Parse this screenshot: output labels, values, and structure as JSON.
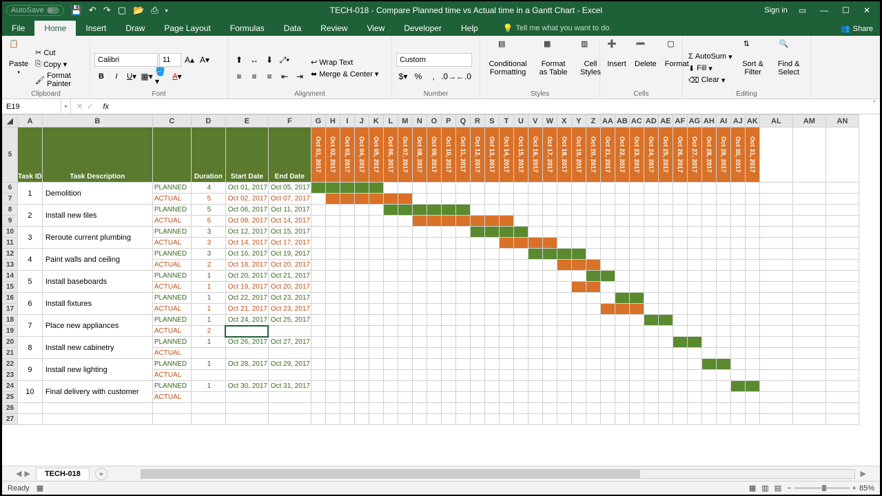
{
  "title": "TECH-018 - Compare Planned time vs Actual time in a Gantt Chart - Excel",
  "autosave": "AutoSave",
  "signin": "Sign in",
  "tabs": [
    "File",
    "Home",
    "Insert",
    "Draw",
    "Page Layout",
    "Formulas",
    "Data",
    "Review",
    "View",
    "Developer",
    "Help"
  ],
  "tellme": "Tell me what you want to do",
  "share": "Share",
  "ribbon": {
    "clipboard": {
      "label": "Clipboard",
      "paste": "Paste",
      "cut": "Cut",
      "copy": "Copy",
      "fp": "Format Painter"
    },
    "font": {
      "label": "Font",
      "name": "Calibri",
      "size": "11"
    },
    "alignment": {
      "label": "Alignment",
      "wrap": "Wrap Text",
      "merge": "Merge & Center"
    },
    "number": {
      "label": "Number",
      "format": "Custom"
    },
    "styles": {
      "label": "Styles",
      "cf": "Conditional Formatting",
      "fat": "Format as Table",
      "cs": "Cell Styles"
    },
    "cells": {
      "label": "Cells",
      "insert": "Insert",
      "delete": "Delete",
      "format": "Format"
    },
    "editing": {
      "label": "Editing",
      "sum": "AutoSum",
      "fill": "Fill",
      "clear": "Clear",
      "sort": "Sort & Filter",
      "find": "Find & Select"
    }
  },
  "namebox": "E19",
  "cols": [
    "A",
    "B",
    "C",
    "D",
    "E",
    "F",
    "G",
    "H",
    "I",
    "J",
    "K",
    "L",
    "M",
    "N",
    "O",
    "P",
    "Q",
    "R",
    "S",
    "T",
    "U",
    "V",
    "W",
    "X",
    "Y",
    "Z",
    "AA",
    "AB",
    "AC",
    "AD",
    "AE",
    "AF",
    "AG",
    "AH",
    "AI",
    "AJ",
    "AK",
    "AL",
    "AM",
    "AN"
  ],
  "headers": {
    "tid": "Task ID",
    "tdesc": "Task Description",
    "dur": "Duration",
    "sdate": "Start Date",
    "edate": "End Date"
  },
  "dates": [
    "Oct 01, 2017",
    "Oct 02, 2017",
    "Oct 03, 2017",
    "Oct 04, 2017",
    "Oct 05, 2017",
    "Oct 06, 2017",
    "Oct 07, 2017",
    "Oct 08, 2017",
    "Oct 09, 2017",
    "Oct 10, 2017",
    "Oct 11, 2017",
    "Oct 12, 2017",
    "Oct 13, 2017",
    "Oct 14, 2017",
    "Oct 15, 2017",
    "Oct 16, 2017",
    "Oct 17, 2017",
    "Oct 18, 2017",
    "Oct 19, 2017",
    "Oct 20, 2017",
    "Oct 21, 2017",
    "Oct 22, 2017",
    "Oct 23, 2017",
    "Oct 24, 2017",
    "Oct 25, 2017",
    "Oct 26, 2017",
    "Oct 27, 2017",
    "Oct 28, 2017",
    "Oct 29, 2017",
    "Oct 30, 2017",
    "Oct 31, 2017"
  ],
  "labels": {
    "planned": "PLANNED",
    "actual": "ACTUAL"
  },
  "tasks": [
    {
      "id": "1",
      "desc": "Demolition",
      "p": {
        "dur": "4",
        "s": "Oct 01, 2017",
        "e": "Oct 05, 2017",
        "g": [
          0,
          4
        ]
      },
      "a": {
        "dur": "5",
        "s": "Oct 02, 2017",
        "e": "Oct 07, 2017",
        "g": [
          1,
          6
        ]
      }
    },
    {
      "id": "2",
      "desc": "Install new tiles",
      "p": {
        "dur": "5",
        "s": "Oct 06, 2017",
        "e": "Oct 11, 2017",
        "g": [
          5,
          10
        ]
      },
      "a": {
        "dur": "6",
        "s": "Oct 08, 2017",
        "e": "Oct 14, 2017",
        "g": [
          7,
          13
        ]
      }
    },
    {
      "id": "3",
      "desc": "Reroute current plumbing",
      "p": {
        "dur": "3",
        "s": "Oct 12, 2017",
        "e": "Oct 15, 2017",
        "g": [
          11,
          14
        ]
      },
      "a": {
        "dur": "3",
        "s": "Oct 14, 2017",
        "e": "Oct 17, 2017",
        "g": [
          13,
          16
        ]
      }
    },
    {
      "id": "4",
      "desc": "Paint walls and ceiling",
      "p": {
        "dur": "3",
        "s": "Oct 16, 2017",
        "e": "Oct 19, 2017",
        "g": [
          15,
          18
        ]
      },
      "a": {
        "dur": "2",
        "s": "Oct 18, 2017",
        "e": "Oct 20, 2017",
        "g": [
          17,
          19
        ]
      }
    },
    {
      "id": "5",
      "desc": "Install baseboards",
      "p": {
        "dur": "1",
        "s": "Oct 20, 2017",
        "e": "Oct 21, 2017",
        "g": [
          19,
          20
        ]
      },
      "a": {
        "dur": "1",
        "s": "Oct 19, 2017",
        "e": "Oct 20, 2017",
        "g": [
          18,
          19
        ]
      }
    },
    {
      "id": "6",
      "desc": "Install fixtures",
      "p": {
        "dur": "1",
        "s": "Oct 22, 2017",
        "e": "Oct 23, 2017",
        "g": [
          21,
          22
        ]
      },
      "a": {
        "dur": "1",
        "s": "Oct 21, 2017",
        "e": "Oct 23, 2017",
        "g": [
          20,
          22
        ]
      }
    },
    {
      "id": "7",
      "desc": "Place new appliances",
      "p": {
        "dur": "1",
        "s": "Oct 24, 2017",
        "e": "Oct 25, 2017",
        "g": [
          23,
          24
        ]
      },
      "a": {
        "dur": "2",
        "s": "",
        "e": "",
        "g": null
      }
    },
    {
      "id": "8",
      "desc": "Install new cabinetry",
      "p": {
        "dur": "1",
        "s": "Oct 26, 2017",
        "e": "Oct 27, 2017",
        "g": [
          25,
          26
        ]
      },
      "a": {
        "dur": "",
        "s": "",
        "e": "",
        "g": null
      }
    },
    {
      "id": "9",
      "desc": "Install new lighting",
      "p": {
        "dur": "1",
        "s": "Oct 28, 2017",
        "e": "Oct 29, 2017",
        "g": [
          27,
          28
        ]
      },
      "a": {
        "dur": "",
        "s": "",
        "e": "",
        "g": null
      }
    },
    {
      "id": "10",
      "desc": "Final delivery with customer",
      "p": {
        "dur": "1",
        "s": "Oct 30, 2017",
        "e": "Oct 31, 2017",
        "g": [
          29,
          30
        ]
      },
      "a": {
        "dur": "",
        "s": "",
        "e": "",
        "g": null
      }
    }
  ],
  "sheet": "TECH-018",
  "status": "Ready",
  "zoom": "85%"
}
